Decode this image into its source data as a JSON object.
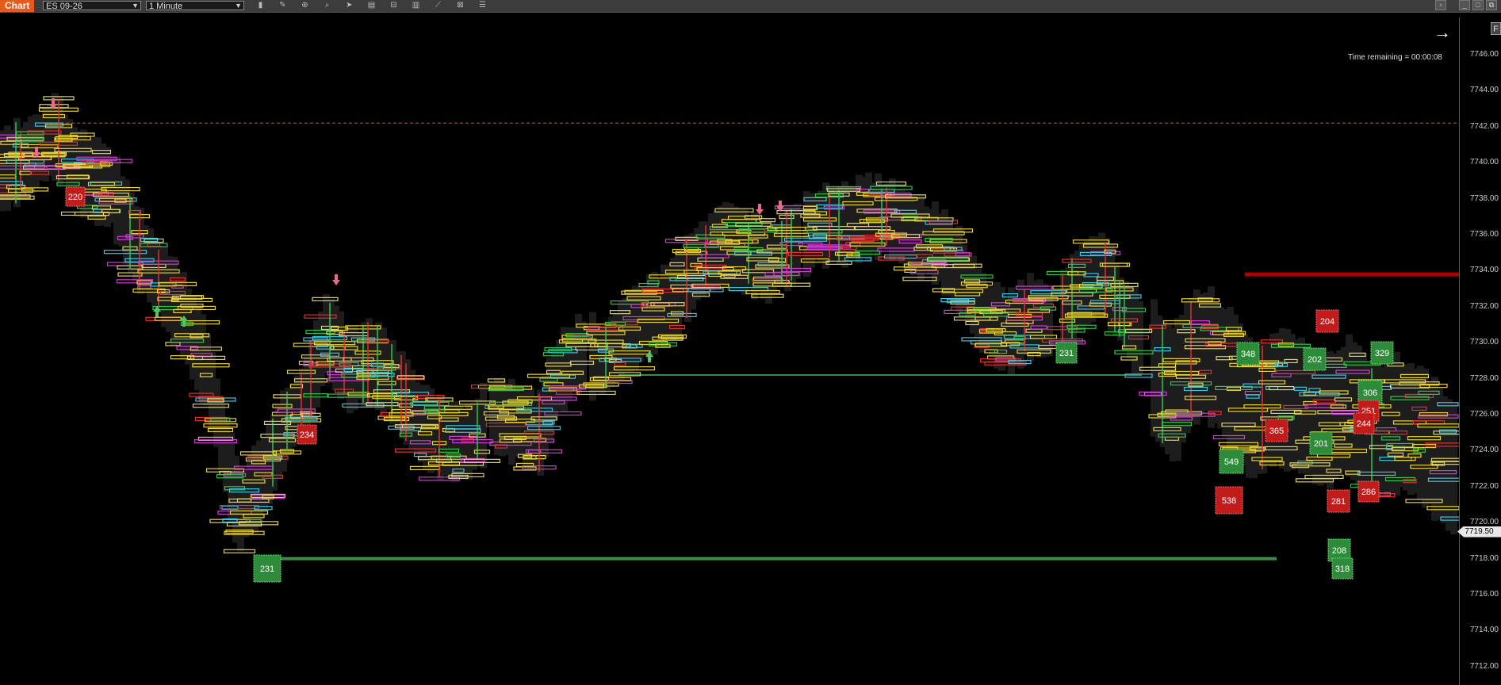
{
  "toolbar": {
    "tab_label": "Chart",
    "instrument": "ES 09-26",
    "interval": "1 Minute"
  },
  "chart": {
    "time_remaining": "Time remaining = 00:00:08",
    "current_price": "7719.50",
    "f_button": "F",
    "price_ticks": [
      "7746.00",
      "7744.00",
      "7742.00",
      "7740.00",
      "7738.00",
      "7736.00",
      "7734.00",
      "7732.00",
      "7730.00",
      "7728.00",
      "7726.00",
      "7724.00",
      "7722.00",
      "7720.00",
      "7718.00",
      "7716.00",
      "7714.00",
      "7712.00"
    ],
    "blocks": [
      {
        "label": "220",
        "kind": "sell"
      },
      {
        "label": "234",
        "kind": "sell"
      },
      {
        "label": "231",
        "kind": "buy"
      },
      {
        "label": "231",
        "kind": "buy"
      },
      {
        "label": "204",
        "kind": "sell"
      },
      {
        "label": "348",
        "kind": "buy"
      },
      {
        "label": "202",
        "kind": "buy"
      },
      {
        "label": "329",
        "kind": "buy"
      },
      {
        "label": "306",
        "kind": "buy"
      },
      {
        "label": "251",
        "kind": "sell"
      },
      {
        "label": "365",
        "kind": "sell"
      },
      {
        "label": "244",
        "kind": "sell"
      },
      {
        "label": "201",
        "kind": "buy"
      },
      {
        "label": "549",
        "kind": "buy"
      },
      {
        "label": "538",
        "kind": "sell"
      },
      {
        "label": "281",
        "kind": "sell"
      },
      {
        "label": "286",
        "kind": "sell"
      },
      {
        "label": "208",
        "kind": "buy"
      },
      {
        "label": "318",
        "kind": "buy"
      }
    ],
    "colors": {
      "background": "#000000",
      "buy_block": "#2e8b3a",
      "sell_block": "#c21b1b",
      "level_line": "#3a8a4a",
      "resistance_line": "#b00000",
      "dashed_line": "#d9455f",
      "bar_yellow": "#e8d23a",
      "bar_cyan": "#3cc6e0",
      "bar_magenta": "#d53ad8",
      "bar_red": "#e03030",
      "bar_green": "#33c24a"
    }
  }
}
